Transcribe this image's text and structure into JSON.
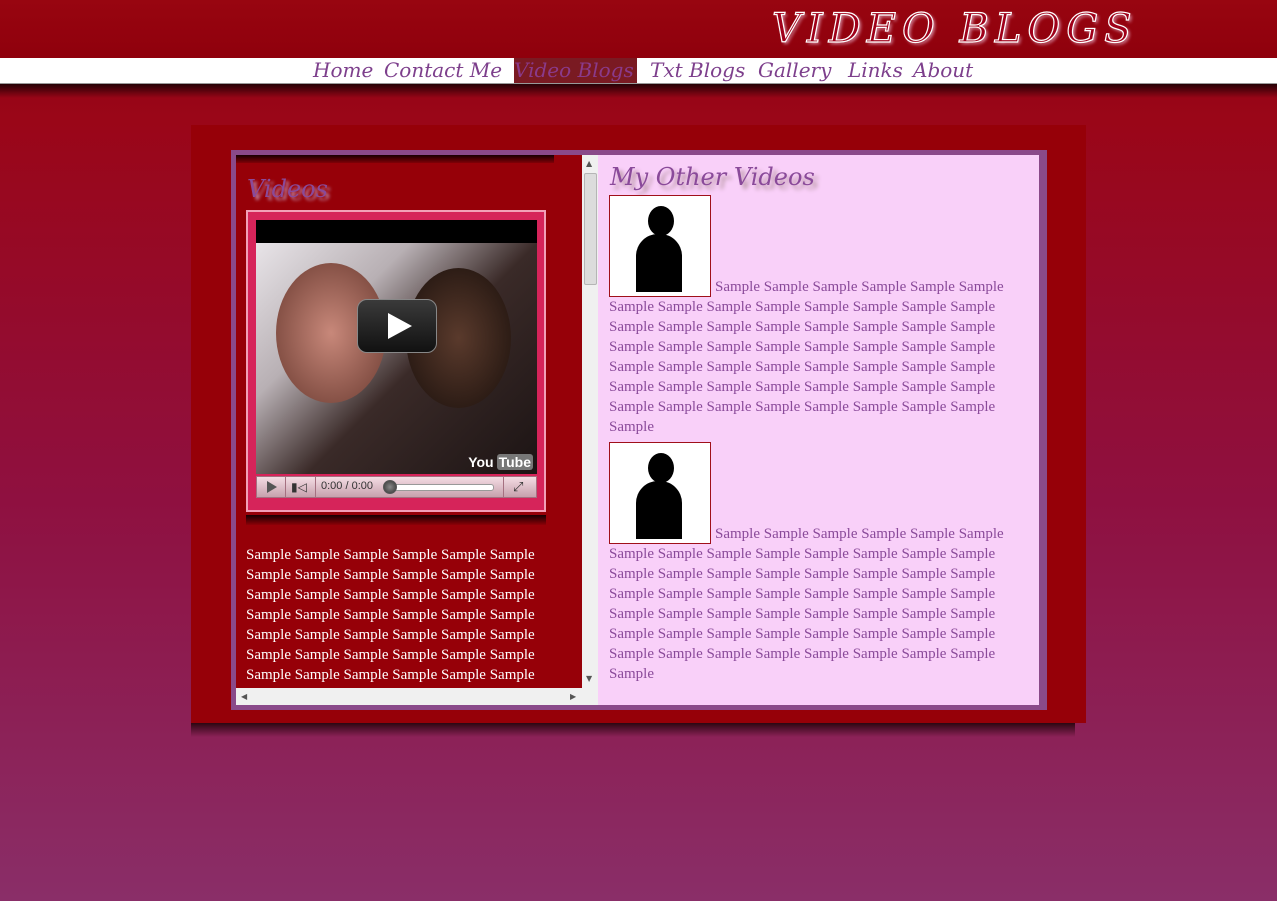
{
  "header": {
    "title": "VIDEO BLOGS"
  },
  "nav": [
    {
      "label": "Home",
      "active": false
    },
    {
      "label": "Contact Me",
      "active": false
    },
    {
      "label": "Video Blogs",
      "active": true
    },
    {
      "label": "Txt Blogs",
      "active": false
    },
    {
      "label": "Gallery",
      "active": false
    },
    {
      "label": "Links",
      "active": false
    },
    {
      "label": "About",
      "active": false
    }
  ],
  "left": {
    "heading": "Videos",
    "player": {
      "time": "0:00 / 0:00",
      "logo_you": "You",
      "logo_tube": "Tube",
      "progress": 0
    },
    "text": "Sample Sample Sample Sample Sample Sample Sample Sample Sample Sample Sample Sample Sample Sample Sample Sample Sample Sample Sample Sample Sample Sample Sample Sample Sample Sample Sample Sample Sample Sample Sample Sample Sample Sample Sample Sample Sample Sample Sample Sample Sample Sample"
  },
  "right": {
    "heading": "My Other Videos",
    "articles": [
      {
        "text": "Sample Sample Sample Sample Sample Sample Sample Sample Sample Sample Sample Sample Sample Sample Sample Sample Sample Sample Sample Sample Sample Sample Sample Sample Sample Sample Sample Sample Sample Sample Sample Sample Sample Sample Sample Sample Sample Sample Sample Sample Sample Sample Sample Sample Sample Sample Sample Sample Sample Sample Sample Sample Sample Sample Sample"
      },
      {
        "text": "Sample Sample Sample Sample Sample Sample Sample Sample Sample Sample Sample Sample Sample Sample Sample Sample Sample Sample Sample Sample Sample Sample Sample Sample Sample Sample Sample Sample Sample Sample Sample Sample Sample Sample Sample Sample Sample Sample Sample Sample Sample Sample Sample Sample Sample Sample Sample Sample Sample Sample Sample Sample Sample Sample Sample"
      }
    ]
  },
  "colors": {
    "brand_red": "#960008",
    "accent_purple": "#8a4a9a",
    "panel_pink": "#f9d0f9"
  }
}
